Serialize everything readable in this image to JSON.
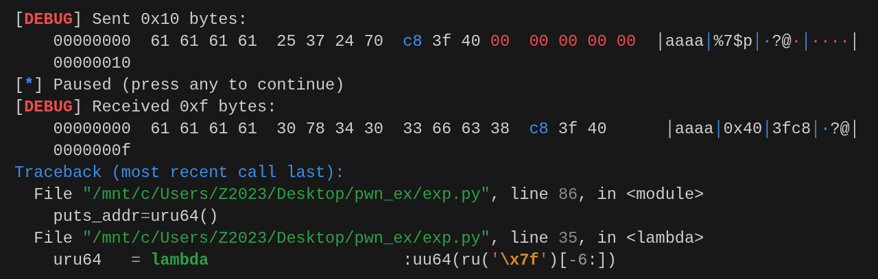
{
  "terminal": {
    "lines": [
      {
        "kind": "log",
        "segments": [
          {
            "kind": "text",
            "text": "["
          },
          {
            "kind": "debug",
            "text": "DEBUG"
          },
          {
            "kind": "text",
            "text": "] Sent 0x10 bytes:"
          }
        ]
      },
      {
        "kind": "dump",
        "segments": [
          {
            "kind": "text",
            "text": "00000000  61 61 61 61  25 37 24 70  "
          },
          {
            "kind": "high",
            "text": "c8"
          },
          {
            "kind": "text",
            "text": " 3f 40 "
          },
          {
            "kind": "zero",
            "text": "00  00 00 00 00"
          },
          {
            "kind": "bar",
            "text": "  │"
          },
          {
            "kind": "text",
            "text": "aaaa"
          },
          {
            "kind": "sep",
            "text": "│"
          },
          {
            "kind": "text",
            "text": "%7$p"
          },
          {
            "kind": "sep",
            "text": "│"
          },
          {
            "kind": "dot-high",
            "text": "·"
          },
          {
            "kind": "text",
            "text": "?@"
          },
          {
            "kind": "dot-zero",
            "text": "·"
          },
          {
            "kind": "sep",
            "text": "│"
          },
          {
            "kind": "dot-zero",
            "text": "····"
          },
          {
            "kind": "bar",
            "text": "│"
          }
        ]
      },
      {
        "kind": "dump",
        "segments": [
          {
            "kind": "text",
            "text": "00000010"
          }
        ]
      },
      {
        "kind": "log",
        "segments": [
          {
            "kind": "text",
            "text": "["
          },
          {
            "kind": "info",
            "text": "*"
          },
          {
            "kind": "text",
            "text": "] Paused (press any to continue)"
          }
        ]
      },
      {
        "kind": "log",
        "segments": [
          {
            "kind": "text",
            "text": "["
          },
          {
            "kind": "debug",
            "text": "DEBUG"
          },
          {
            "kind": "text",
            "text": "] Received 0xf bytes:"
          }
        ]
      },
      {
        "kind": "dump",
        "segments": [
          {
            "kind": "text",
            "text": "00000000  61 61 61 61  30 78 34 30  33 66 63 38  "
          },
          {
            "kind": "high",
            "text": "c8"
          },
          {
            "kind": "text",
            "text": " 3f 40"
          },
          {
            "kind": "bar",
            "text": "      │"
          },
          {
            "kind": "text",
            "text": "aaaa"
          },
          {
            "kind": "sep",
            "text": "│"
          },
          {
            "kind": "text",
            "text": "0x40"
          },
          {
            "kind": "sep",
            "text": "│"
          },
          {
            "kind": "text",
            "text": "3fc8"
          },
          {
            "kind": "sep",
            "text": "│"
          },
          {
            "kind": "dot-high",
            "text": "·"
          },
          {
            "kind": "text",
            "text": "?@"
          },
          {
            "kind": "bar",
            "text": "│"
          }
        ]
      },
      {
        "kind": "dump",
        "segments": [
          {
            "kind": "text",
            "text": "0000000f"
          }
        ]
      },
      {
        "kind": "log",
        "segments": [
          {
            "kind": "traceback",
            "text": "Traceback (most recent call last):"
          }
        ]
      },
      {
        "kind": "frame",
        "segments": [
          {
            "kind": "text",
            "text": "File "
          },
          {
            "kind": "path",
            "text": "\"/mnt/c/Users/Z2023/Desktop/pwn_ex/exp.py\""
          },
          {
            "kind": "text",
            "text": ", line "
          },
          {
            "kind": "lineno",
            "text": "86"
          },
          {
            "kind": "text",
            "text": ", in <module>"
          }
        ]
      },
      {
        "kind": "source",
        "segments": [
          {
            "kind": "text",
            "text": "puts_addr"
          },
          {
            "kind": "op",
            "text": "="
          },
          {
            "kind": "text",
            "text": "uru64()"
          }
        ]
      },
      {
        "kind": "frame",
        "segments": [
          {
            "kind": "text",
            "text": "File "
          },
          {
            "kind": "path",
            "text": "\"/mnt/c/Users/Z2023/Desktop/pwn_ex/exp.py\""
          },
          {
            "kind": "text",
            "text": ", line "
          },
          {
            "kind": "lineno",
            "text": "35"
          },
          {
            "kind": "text",
            "text": ", in <lambda>"
          }
        ]
      },
      {
        "kind": "source",
        "segments": [
          {
            "kind": "text",
            "text": "uru64   "
          },
          {
            "kind": "op",
            "text": "= "
          },
          {
            "kind": "keyword",
            "text": "lambda"
          },
          {
            "kind": "text",
            "text": "                    :uu64(ru("
          },
          {
            "kind": "quote",
            "text": "'"
          },
          {
            "kind": "escape",
            "text": "\\x7f"
          },
          {
            "kind": "quote",
            "text": "'"
          },
          {
            "kind": "text",
            "text": ")["
          },
          {
            "kind": "op",
            "text": "-6"
          },
          {
            "kind": "text",
            "text": ":])"
          }
        ]
      }
    ]
  }
}
